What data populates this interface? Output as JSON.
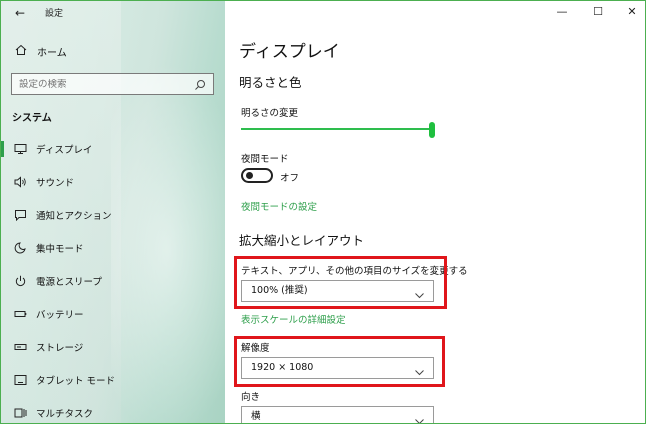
{
  "window": {
    "app_title": "設定",
    "back_symbol": "←",
    "controls": {
      "minimize": "—",
      "maximize": "☐",
      "close": "✕"
    }
  },
  "sidebar": {
    "home_label": "ホーム",
    "search_placeholder": "設定の検索",
    "section_label": "システム",
    "items": [
      {
        "label": "ディスプレイ",
        "icon": "monitor-icon",
        "active": true
      },
      {
        "label": "サウンド",
        "icon": "speaker-icon",
        "active": false
      },
      {
        "label": "通知とアクション",
        "icon": "notification-icon",
        "active": false
      },
      {
        "label": "集中モード",
        "icon": "moon-icon",
        "active": false
      },
      {
        "label": "電源とスリープ",
        "icon": "power-icon",
        "active": false
      },
      {
        "label": "バッテリー",
        "icon": "battery-icon",
        "active": false
      },
      {
        "label": "ストレージ",
        "icon": "storage-icon",
        "active": false
      },
      {
        "label": "タブレット モード",
        "icon": "tablet-icon",
        "active": false
      },
      {
        "label": "マルチタスク",
        "icon": "multitask-icon",
        "active": false
      }
    ]
  },
  "main": {
    "page_title": "ディスプレイ",
    "brightness_color_header": "明るさと色",
    "brightness_label": "明るさの変更",
    "brightness_level": 1.0,
    "night_mode_label": "夜間モード",
    "night_mode_state": "オフ",
    "night_mode_settings_link": "夜間モードの設定",
    "scale_layout_header": "拡大縮小とレイアウト",
    "text_size_label": "テキスト、アプリ、その他の項目のサイズを変更する",
    "scale_value": "100% (推奨)",
    "advanced_scale_link": "表示スケールの詳細設定",
    "resolution_label": "解像度",
    "resolution_value": "1920 × 1080",
    "orientation_label": "向き",
    "orientation_value": "横"
  },
  "colors": {
    "accent": "#2e9f4b",
    "highlight_box": "#e0161b"
  }
}
